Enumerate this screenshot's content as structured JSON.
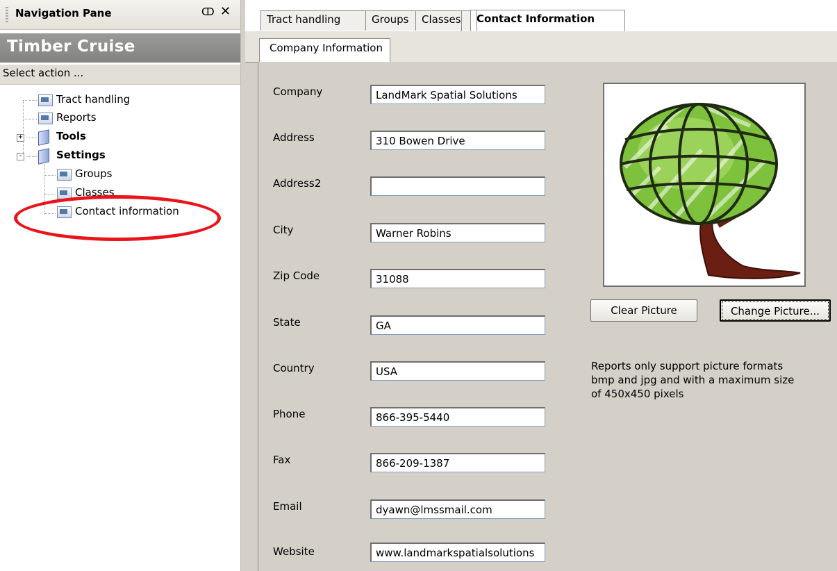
{
  "nav": {
    "header_title": "Navigation Pane",
    "pin_glyph": "ↀ",
    "close_glyph": "✕",
    "app_title": "Timber Cruise",
    "select_action": "Select action ...",
    "tree": [
      {
        "label": "Tract handling",
        "icon": "page-icon"
      },
      {
        "label": "Reports",
        "icon": "page-icon"
      },
      {
        "label": "Tools",
        "icon": "folder-icon",
        "expander": "+"
      },
      {
        "label": "Settings",
        "icon": "folder-icon",
        "expander": "-"
      },
      {
        "label": "Groups",
        "icon": "page-icon"
      },
      {
        "label": "Classes",
        "icon": "page-icon"
      },
      {
        "label": "Contact information",
        "icon": "page-icon"
      }
    ]
  },
  "tabs": [
    "Tract handling",
    "Groups",
    "Classes",
    "Contact Information"
  ],
  "subtab": "Company Information",
  "form": {
    "fields": [
      {
        "label": "Company",
        "value": "LandMark Spatial Solutions"
      },
      {
        "label": "Address",
        "value": "310 Bowen Drive"
      },
      {
        "label": "Address2",
        "value": ""
      },
      {
        "label": "City",
        "value": "Warner Robins"
      },
      {
        "label": "Zip Code",
        "value": "31088"
      },
      {
        "label": "State",
        "value": "GA"
      },
      {
        "label": "Country",
        "value": "USA"
      },
      {
        "label": "Phone",
        "value": "866-395-5440"
      },
      {
        "label": "Fax",
        "value": "866-209-1387"
      },
      {
        "label": "Email",
        "value": "dyawn@lmssmail.com"
      },
      {
        "label": "Website",
        "value": "www.landmarkspatialsolutions"
      }
    ]
  },
  "picture": {
    "image": "tree-globe-logo",
    "clear_label": "Clear Picture",
    "change_label": "Change Picture...",
    "note": "Reports only support picture formats bmp and jpg and with a maximum size of 450x450 pixels"
  },
  "colors": {
    "highlight": "#e8151b",
    "panel": "#d4d0c8",
    "title_bar": "#8f8f8d"
  }
}
